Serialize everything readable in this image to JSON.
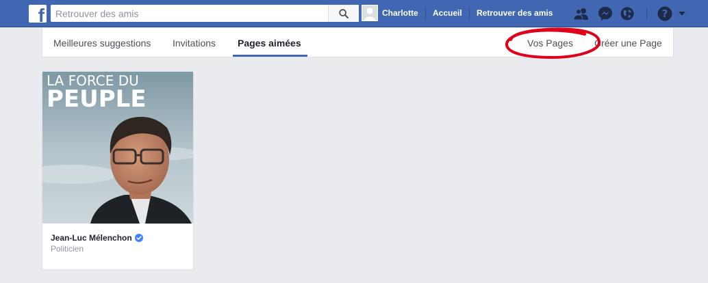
{
  "topbar": {
    "search_placeholder": "Retrouver des amis",
    "user_name": "Charlotte",
    "home_label": "Accueil",
    "find_friends_label": "Retrouver des amis"
  },
  "tabs": {
    "suggestions": "Meilleures suggestions",
    "invitations": "Invitations",
    "liked_pages": "Pages aimées",
    "your_pages": "Vos Pages",
    "create_page": "Créer une Page"
  },
  "card": {
    "poster_line1": "LA FORCE DU",
    "poster_line2": "PEUPLE",
    "name": "Jean-Luc Mélenchon",
    "category": "Politicien"
  },
  "colors": {
    "brand": "#4267b2",
    "annotation": "#e0001a"
  },
  "icons": [
    "facebook-logo-icon",
    "search-icon",
    "friend-requests-icon",
    "messenger-icon",
    "notifications-globe-icon",
    "help-icon",
    "caret-down-icon",
    "verified-badge-icon"
  ]
}
